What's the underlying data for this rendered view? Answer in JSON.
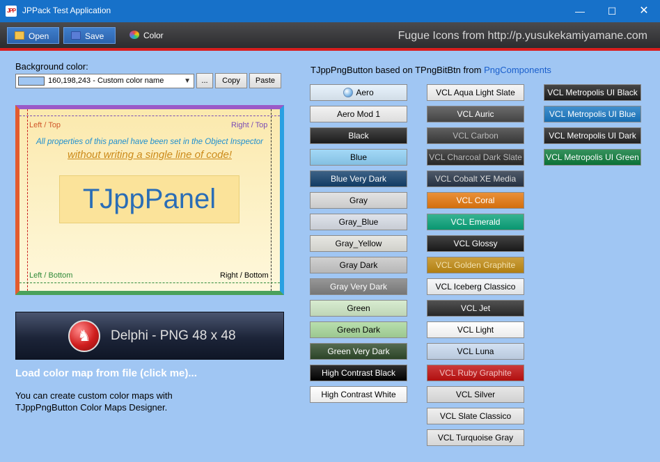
{
  "window": {
    "title": "JPPack Test Application",
    "app_icon_text": "JPP"
  },
  "toolbar": {
    "open_label": "Open",
    "save_label": "Save",
    "color_label": "Color",
    "credit_text": "Fugue Icons from http://p.yusukekamiyamane.com"
  },
  "background": {
    "label": "Background color:",
    "combo_value": "160,198,243 - Custom color name",
    "ellipsis_label": "...",
    "copy_label": "Copy",
    "paste_label": "Paste",
    "swatch_color": "#a0c6f3"
  },
  "panel": {
    "left_top": "Left / Top",
    "right_top": "Right / Top",
    "left_bottom": "Left / Bottom",
    "right_bottom": "Right / Bottom",
    "info_line": "All properties of this panel have been set in the Object Inspector",
    "emphasis_line": "without writing a single line of code!",
    "caption": "TJppPanel"
  },
  "delphi_button": {
    "label": "Delphi - PNG 48 x 48"
  },
  "load_link": "Load color map from file (click me)...",
  "info_text": {
    "line1": "You can create custom color maps with",
    "line2": "TJppPngButton Color Maps Designer."
  },
  "right_header": {
    "prefix": "TJppPngButton based on TPngBitBtn from",
    "link": "PngComponents"
  },
  "buttons": {
    "col1": [
      {
        "label": "Aero",
        "bg": "#e3f0fb",
        "fg": "#000"
      },
      {
        "label": "Aero Mod 1",
        "bg": "#f0f0f0",
        "fg": "#000"
      },
      {
        "label": "Black",
        "bg": "#1e1e1e",
        "fg": "#fff"
      },
      {
        "label": "Blue",
        "bg": "#8fd0f5",
        "fg": "#000"
      },
      {
        "label": "Blue Very Dark",
        "bg": "#13406c",
        "fg": "#fff"
      },
      {
        "label": "Gray",
        "bg": "#dcdcdc",
        "fg": "#000"
      },
      {
        "label": "Gray_Blue",
        "bg": "#d8dde6",
        "fg": "#000"
      },
      {
        "label": "Gray_Yellow",
        "bg": "#e2e2dc",
        "fg": "#000"
      },
      {
        "label": "Gray Dark",
        "bg": "#c6c6c6",
        "fg": "#000"
      },
      {
        "label": "Gray Very Dark",
        "bg": "#808080",
        "fg": "#fff"
      },
      {
        "label": "Green",
        "bg": "#cfe8c6",
        "fg": "#000"
      },
      {
        "label": "Green Dark",
        "bg": "#a9d89c",
        "fg": "#000"
      },
      {
        "label": "Green Very Dark",
        "bg": "#2f4a2a",
        "fg": "#fff"
      },
      {
        "label": "High Contrast Black",
        "bg": "#000000",
        "fg": "#fff"
      },
      {
        "label": "High Contrast White",
        "bg": "#ffffff",
        "fg": "#000"
      }
    ],
    "col2": [
      {
        "label": "VCL Aqua Light Slate",
        "bg": "#f4f4f4",
        "fg": "#000"
      },
      {
        "label": "VCL Auric",
        "bg": "#4a4a4a",
        "fg": "#fff"
      },
      {
        "label": "VCL Carbon",
        "bg": "#3c3c3c",
        "fg": "#bbb"
      },
      {
        "label": "VCL Charcoal Dark Slate",
        "bg": "#2a2a2a",
        "fg": "#bbb"
      },
      {
        "label": "VCL Cobalt XE Media",
        "bg": "#283548",
        "fg": "#ddd"
      },
      {
        "label": "VCL Coral",
        "bg": "#e5780e",
        "fg": "#fff"
      },
      {
        "label": "VCL Emerald",
        "bg": "#0aa37a",
        "fg": "#fff"
      },
      {
        "label": "VCL Glossy",
        "bg": "#1a1a1a",
        "fg": "#fff"
      },
      {
        "label": "VCL Golden Graphite",
        "bg": "#c08a12",
        "fg": "#f3e2b0"
      },
      {
        "label": "VCL Iceberg Classico",
        "bg": "#f4f6f8",
        "fg": "#000"
      },
      {
        "label": "VCL Jet",
        "bg": "#2b2b2b",
        "fg": "#fff"
      },
      {
        "label": "VCL Light",
        "bg": "#ffffff",
        "fg": "#000"
      },
      {
        "label": "VCL Luna",
        "bg": "#c9daf0",
        "fg": "#000"
      },
      {
        "label": "VCL Ruby Graphite",
        "bg": "#c01010",
        "fg": "#f3c0c0"
      },
      {
        "label": "VCL Silver",
        "bg": "#e2e2e2",
        "fg": "#000"
      },
      {
        "label": "VCL Slate Classico",
        "bg": "#ececec",
        "fg": "#000"
      },
      {
        "label": "VCL Turquoise Gray",
        "bg": "#e8e8e8",
        "fg": "#000"
      }
    ],
    "col3": [
      {
        "label": "VCL Metropolis UI Black",
        "bg": "#1e1e1e",
        "fg": "#fff"
      },
      {
        "label": "VCL Metropolis UI Blue",
        "bg": "#1a78c2",
        "fg": "#fff"
      },
      {
        "label": "VCL Metropolis UI Dark",
        "bg": "#242424",
        "fg": "#fff"
      },
      {
        "label": "VCL Metropolis UI Green",
        "bg": "#0b7a3a",
        "fg": "#fff"
      }
    ]
  }
}
